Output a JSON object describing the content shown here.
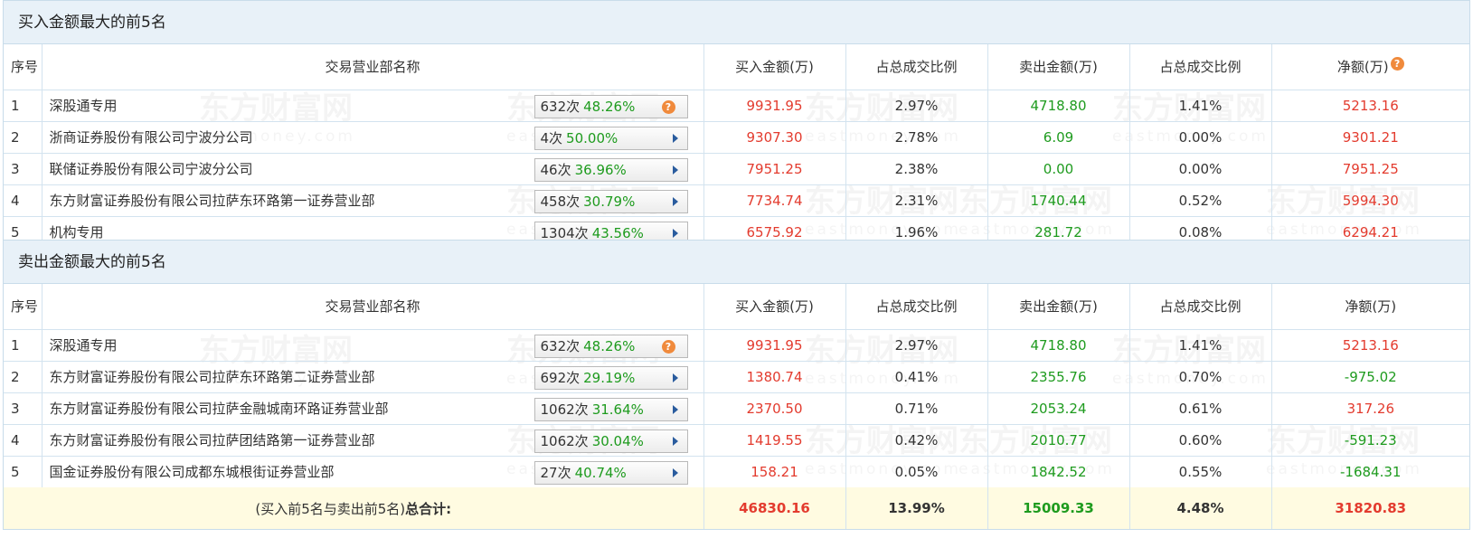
{
  "buy_section": {
    "title": "买入金额最大的前5名",
    "headers": [
      "序号",
      "交易营业部名称",
      "买入金额(万)",
      "占总成交比例",
      "卖出金额(万)",
      "占总成交比例",
      "净额(万)"
    ],
    "rows": [
      {
        "seq": "1",
        "name": "深股通专用",
        "times": "632次",
        "rate": "48.26%",
        "badge_icon": "question-icon",
        "buy": "9931.95",
        "buy_pct": "2.97%",
        "sell": "4718.80",
        "sell_pct": "1.41%",
        "net": "5213.16"
      },
      {
        "seq": "2",
        "name": "浙商证券股份有限公司宁波分公司",
        "times": "4次",
        "rate": "50.00%",
        "badge_icon": "arrow-right-icon",
        "buy": "9307.30",
        "buy_pct": "2.78%",
        "sell": "6.09",
        "sell_pct": "0.00%",
        "net": "9301.21"
      },
      {
        "seq": "3",
        "name": "联储证券股份有限公司宁波分公司",
        "times": "46次",
        "rate": "36.96%",
        "badge_icon": "arrow-right-icon",
        "buy": "7951.25",
        "buy_pct": "2.38%",
        "sell": "0.00",
        "sell_pct": "0.00%",
        "net": "7951.25"
      },
      {
        "seq": "4",
        "name": "东方财富证券股份有限公司拉萨东环路第一证券营业部",
        "times": "458次",
        "rate": "30.79%",
        "badge_icon": "arrow-right-icon",
        "buy": "7734.74",
        "buy_pct": "2.31%",
        "sell": "1740.44",
        "sell_pct": "0.52%",
        "net": "5994.30"
      },
      {
        "seq": "5",
        "name": "机构专用",
        "times": "1304次",
        "rate": "43.56%",
        "badge_icon": "arrow-right-icon",
        "buy": "6575.92",
        "buy_pct": "1.96%",
        "sell": "281.72",
        "sell_pct": "0.08%",
        "net": "6294.21"
      }
    ]
  },
  "sell_section": {
    "title": "卖出金额最大的前5名",
    "headers": [
      "序号",
      "交易营业部名称",
      "买入金额(万)",
      "占总成交比例",
      "卖出金额(万)",
      "占总成交比例",
      "净额(万)"
    ],
    "rows": [
      {
        "seq": "1",
        "name": "深股通专用",
        "times": "632次",
        "rate": "48.26%",
        "badge_icon": "question-icon",
        "buy": "9931.95",
        "buy_pct": "2.97%",
        "sell": "4718.80",
        "sell_pct": "1.41%",
        "net": "5213.16"
      },
      {
        "seq": "2",
        "name": "东方财富证券股份有限公司拉萨东环路第二证券营业部",
        "times": "692次",
        "rate": "29.19%",
        "badge_icon": "arrow-right-icon",
        "buy": "1380.74",
        "buy_pct": "0.41%",
        "sell": "2355.76",
        "sell_pct": "0.70%",
        "net": "-975.02"
      },
      {
        "seq": "3",
        "name": "东方财富证券股份有限公司拉萨金融城南环路证券营业部",
        "times": "1062次",
        "rate": "31.64%",
        "badge_icon": "arrow-right-icon",
        "buy": "2370.50",
        "buy_pct": "0.71%",
        "sell": "2053.24",
        "sell_pct": "0.61%",
        "net": "317.26"
      },
      {
        "seq": "4",
        "name": "东方财富证券股份有限公司拉萨团结路第一证券营业部",
        "times": "1062次",
        "rate": "30.04%",
        "badge_icon": "arrow-right-icon",
        "buy": "1419.55",
        "buy_pct": "0.42%",
        "sell": "2010.77",
        "sell_pct": "0.60%",
        "net": "-591.23"
      },
      {
        "seq": "5",
        "name": "国金证券股份有限公司成都东城根街证券营业部",
        "times": "27次",
        "rate": "40.74%",
        "badge_icon": "arrow-right-icon",
        "buy": "158.21",
        "buy_pct": "0.05%",
        "sell": "1842.52",
        "sell_pct": "0.55%",
        "net": "-1684.31"
      }
    ]
  },
  "total": {
    "label_prefix": "(买入前5名与卖出前5名)",
    "label_bold": "总合计:",
    "buy": "46830.16",
    "buy_pct": "13.99%",
    "sell": "15009.33",
    "sell_pct": "4.48%",
    "net": "31820.83"
  },
  "watermark": {
    "cn": "东方财富网",
    "en": "eastmoney.com"
  },
  "colors": {
    "red": "#e33b2e",
    "green": "#1e9b1e",
    "header_bg": "#e8f1f8",
    "total_bg": "#fffbe1",
    "badge_question": "#f08a3c",
    "badge_arrow": "#2a5c9e"
  }
}
